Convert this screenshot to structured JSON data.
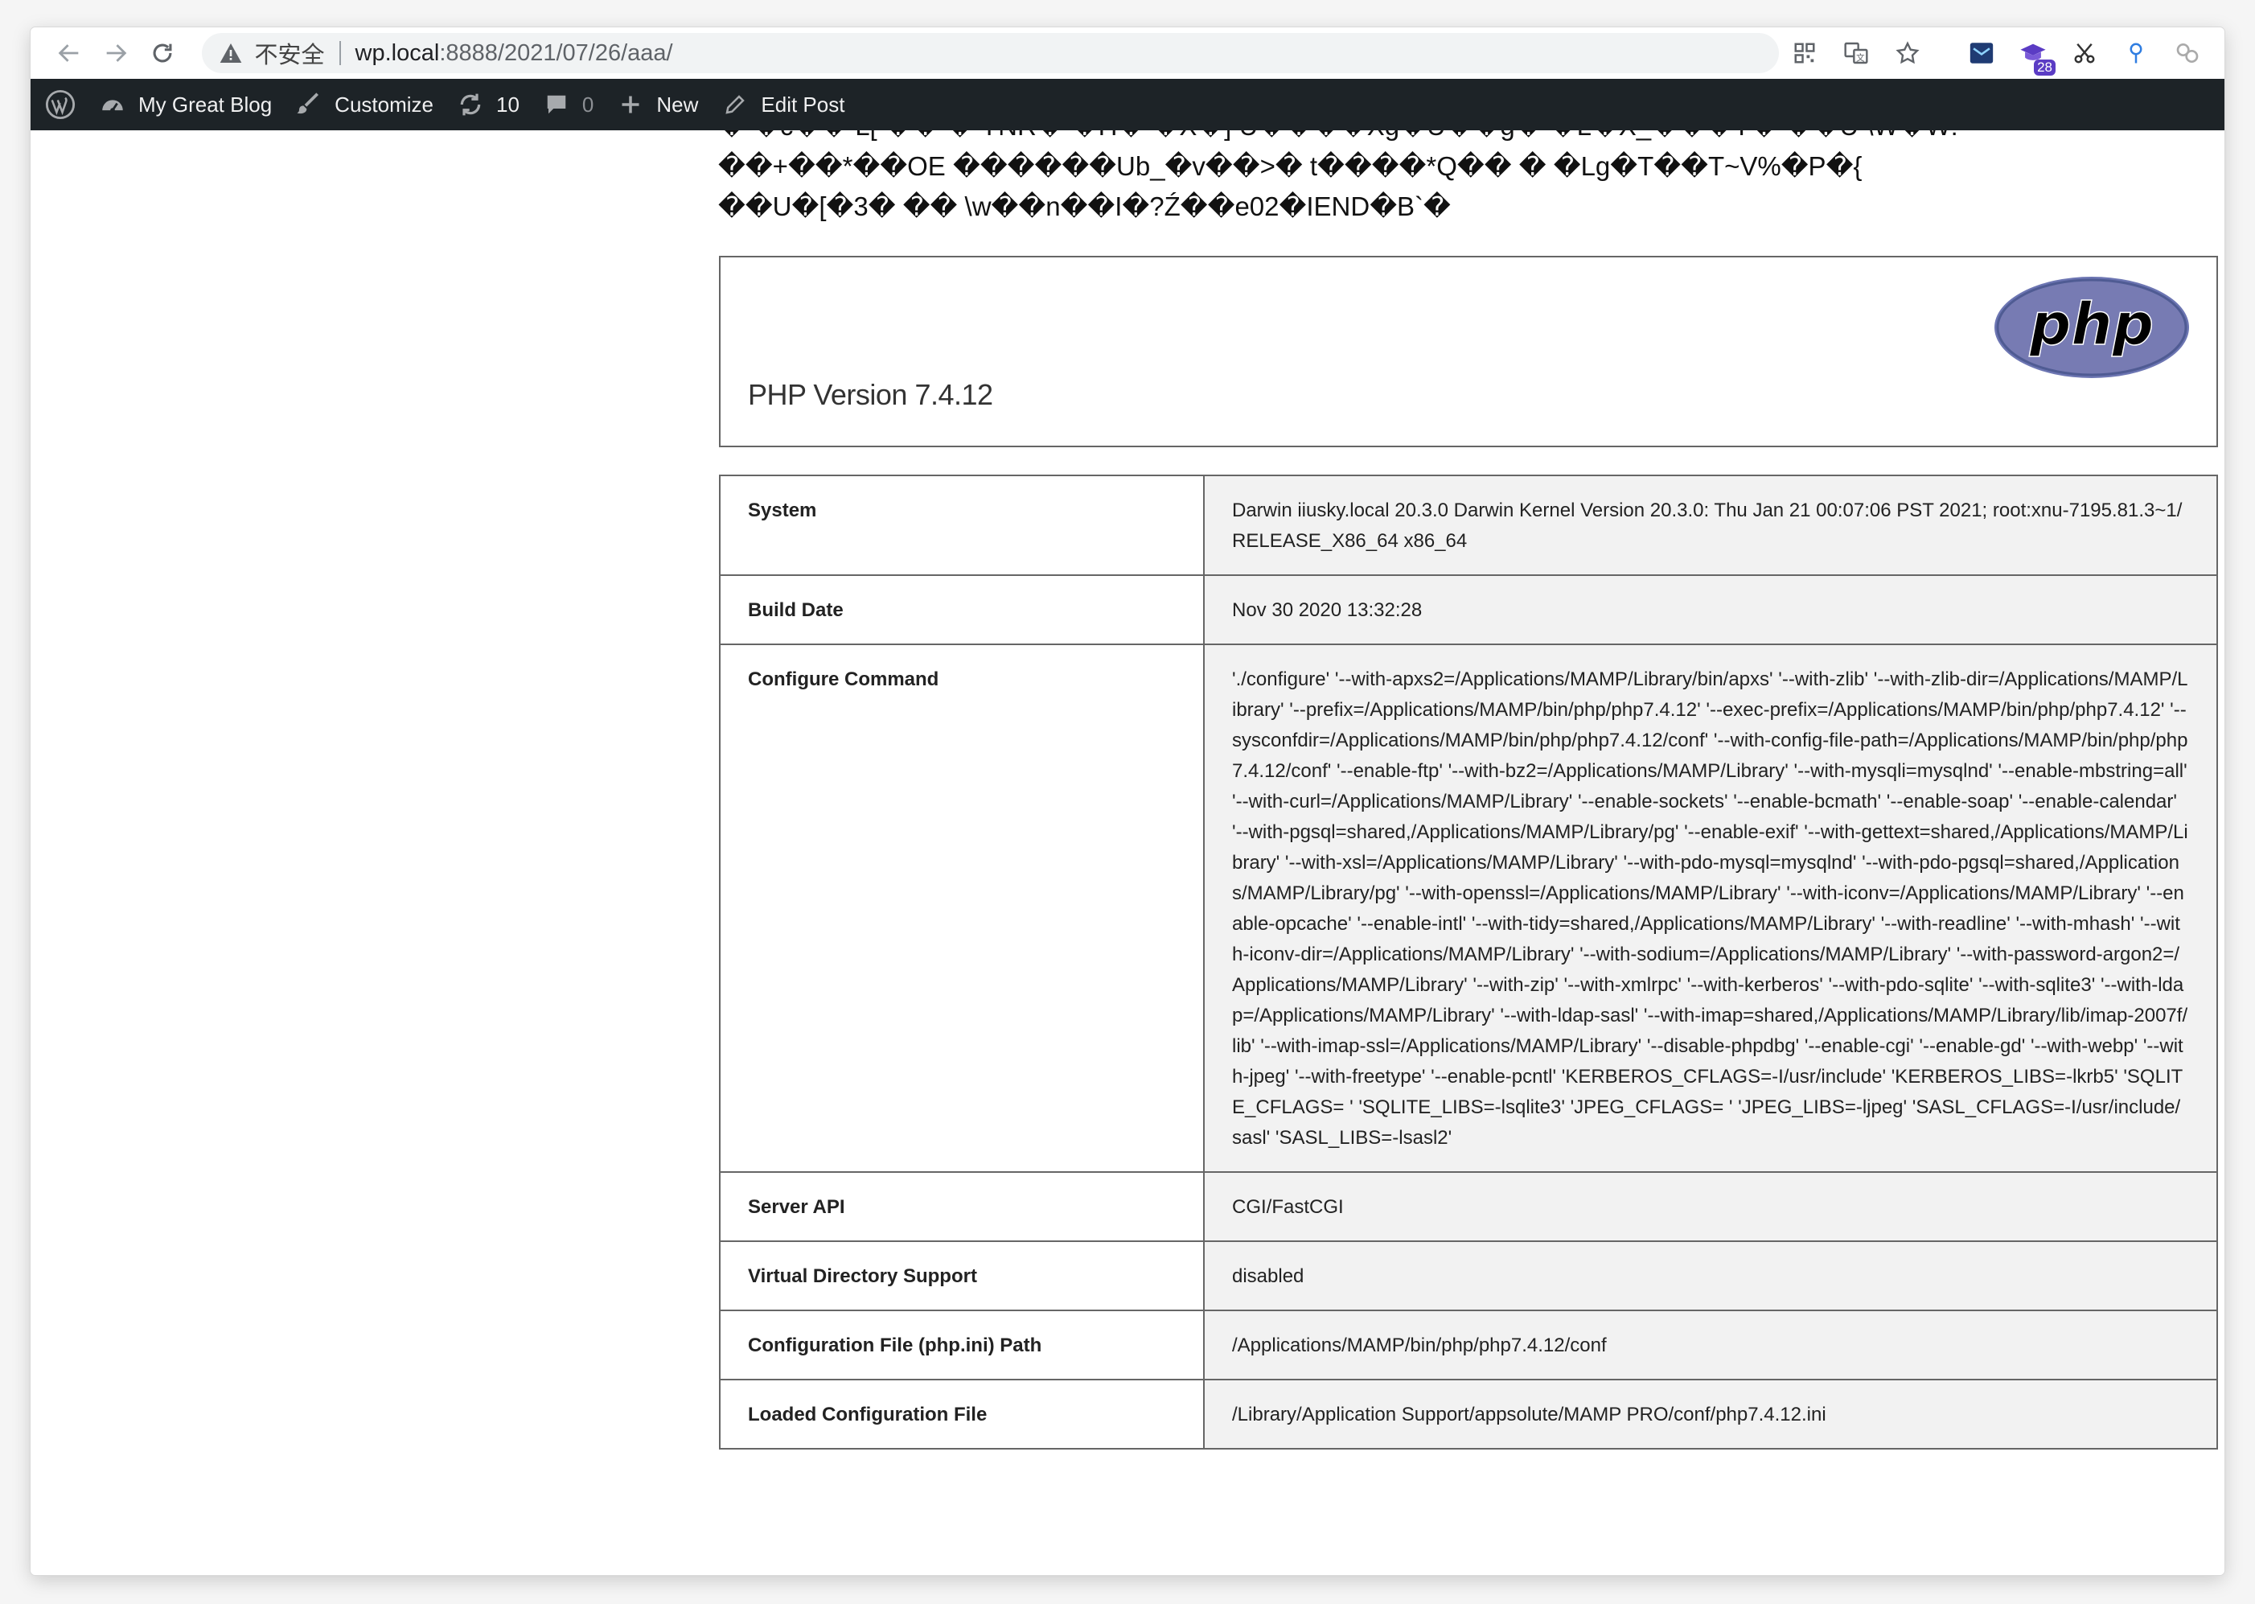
{
  "browser": {
    "security_label": "不安全",
    "url_host": "wp.local",
    "url_rest": ":8888/2021/07/26/aaa/",
    "extension_badge": "28"
  },
  "adminbar": {
    "site_name": "My Great Blog",
    "customize": "Customize",
    "updates_count": "10",
    "comments_count": "0",
    "new": "New",
    "edit_post": "Edit Post"
  },
  "binary_lines": [
    "� �c�� L[ �� � YNR� �H� �X�] U����Xg�U��g� �L�X_���Y� ��U \\W�W!",
    "��+��*��OE ������Ub_�v��>� t����*Q�� � �Lg�T��T~V%�P�{",
    "��U�[�3� �� \\w��n��I�?Ź��e02�IEND�B`�"
  ],
  "php": {
    "version": "PHP Version 7.4.12",
    "logo_text": "php"
  },
  "info_rows": [
    {
      "key": "System",
      "value": "Darwin iiusky.local 20.3.0 Darwin Kernel Version 20.3.0: Thu Jan 21 00:07:06 PST 2021; root:xnu-7195.81.3~1/RELEASE_X86_64 x86_64"
    },
    {
      "key": "Build Date",
      "value": "Nov 30 2020 13:32:28"
    },
    {
      "key": "Configure Command",
      "value": "'./configure' '--with-apxs2=/Applications/MAMP/Library/bin/apxs' '--with-zlib' '--with-zlib-dir=/Applications/MAMP/Library' '--prefix=/Applications/MAMP/bin/php/php7.4.12' '--exec-prefix=/Applications/MAMP/bin/php/php7.4.12' '--sysconfdir=/Applications/MAMP/bin/php/php7.4.12/conf' '--with-config-file-path=/Applications/MAMP/bin/php/php7.4.12/conf' '--enable-ftp' '--with-bz2=/Applications/MAMP/Library' '--with-mysqli=mysqlnd' '--enable-mbstring=all' '--with-curl=/Applications/MAMP/Library' '--enable-sockets' '--enable-bcmath' '--enable-soap' '--enable-calendar' '--with-pgsql=shared,/Applications/MAMP/Library/pg' '--enable-exif' '--with-gettext=shared,/Applications/MAMP/Library' '--with-xsl=/Applications/MAMP/Library' '--with-pdo-mysql=mysqlnd' '--with-pdo-pgsql=shared,/Applications/MAMP/Library/pg' '--with-openssl=/Applications/MAMP/Library' '--with-iconv=/Applications/MAMP/Library' '--enable-opcache' '--enable-intl' '--with-tidy=shared,/Applications/MAMP/Library' '--with-readline' '--with-mhash' '--with-iconv-dir=/Applications/MAMP/Library' '--with-sodium=/Applications/MAMP/Library' '--with-password-argon2=/Applications/MAMP/Library' '--with-zip' '--with-xmlrpc' '--with-kerberos' '--with-pdo-sqlite' '--with-sqlite3' '--with-ldap=/Applications/MAMP/Library' '--with-ldap-sasl' '--with-imap=shared,/Applications/MAMP/Library/lib/imap-2007f/lib' '--with-imap-ssl=/Applications/MAMP/Library' '--disable-phpdbg' '--enable-cgi' '--enable-gd' '--with-webp' '--with-jpeg' '--with-freetype' '--enable-pcntl' 'KERBEROS_CFLAGS=-I/usr/include' 'KERBEROS_LIBS=-lkrb5' 'SQLITE_CFLAGS= ' 'SQLITE_LIBS=-lsqlite3' 'JPEG_CFLAGS= ' 'JPEG_LIBS=-ljpeg' 'SASL_CFLAGS=-I/usr/include/sasl' 'SASL_LIBS=-lsasl2'"
    },
    {
      "key": "Server API",
      "value": "CGI/FastCGI"
    },
    {
      "key": "Virtual Directory Support",
      "value": "disabled"
    },
    {
      "key": "Configuration File (php.ini) Path",
      "value": "/Applications/MAMP/bin/php/php7.4.12/conf"
    },
    {
      "key": "Loaded Configuration File",
      "value": "/Library/Application Support/appsolute/MAMP PRO/conf/php7.4.12.ini"
    }
  ]
}
